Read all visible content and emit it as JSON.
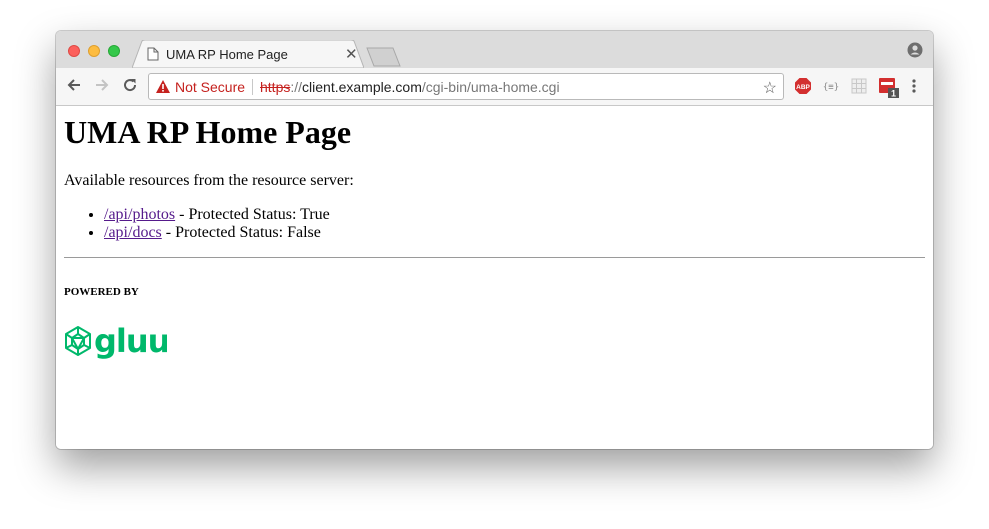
{
  "browser": {
    "tab": {
      "title": "UMA RP Home Page"
    },
    "address_bar": {
      "security_label": "Not Secure",
      "scheme": "https",
      "separator": "://",
      "host": "client.example.com",
      "path": "/cgi-bin/uma-home.cgi"
    },
    "extensions": [
      "adblock-plus-icon",
      "json-viewer-icon",
      "grid-extension-icon",
      "calendar-extension-icon"
    ],
    "extension_badge": "1"
  },
  "page": {
    "heading": "UMA RP Home Page",
    "intro": "Available resources from the resource server:",
    "resources": [
      {
        "link": "/api/photos",
        "status": " - Protected Status: True"
      },
      {
        "link": "/api/docs",
        "status": " - Protected Status: False"
      }
    ],
    "powered_by": "POWERED BY",
    "logo_text": "gluu"
  },
  "colors": {
    "not_secure": "#c5221f",
    "link_visited": "#551a8b",
    "gluu_green": "#00b86b"
  }
}
